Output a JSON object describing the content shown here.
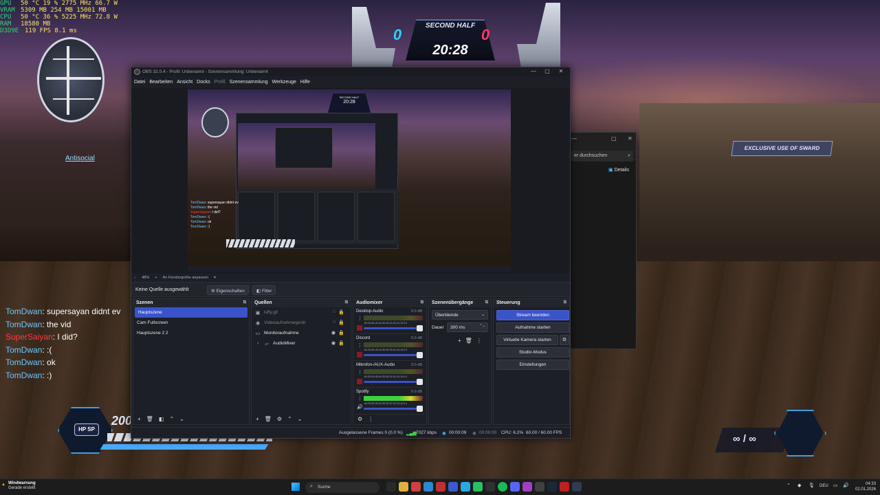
{
  "perf": {
    "rows": [
      {
        "k": "GPU",
        "v": "50 °C  19 %  2775 MHz  66.7 W"
      },
      {
        "k": "VRAM",
        "v": "5309 MB  254 MB  15001 MB"
      },
      {
        "k": "CPU",
        "v": "50 °C  36 %  5225 MHz  72.8 W"
      },
      {
        "k": "RAM",
        "v": "18580 MB"
      },
      {
        "k": "D3D9E",
        "v": "119 FPS  8.1 ms"
      }
    ]
  },
  "game": {
    "half_label": "SECOND HALF",
    "clock": "20:28",
    "score_left": "0",
    "score_right": "0",
    "player_tag": "Antisocial",
    "banner": "EXCLUSIVE USE OF SWARD",
    "hud_hp": "HP",
    "hud_sp": "SP",
    "hud_value": "200",
    "ammo": "∞ / ∞"
  },
  "chat": [
    {
      "name": "TomDwan",
      "msg": "supersayan didnt ev",
      "color": "#6cc6ff"
    },
    {
      "name": "TomDwan",
      "msg": "the vid",
      "color": "#6cc6ff"
    },
    {
      "name": "SuperSaiyan",
      "msg": "I did?",
      "color": "#ff3a44"
    },
    {
      "name": "TomDwan",
      "msg": ":(",
      "color": "#6cc6ff"
    },
    {
      "name": "TomDwan",
      "msg": "ok",
      "color": "#6cc6ff"
    },
    {
      "name": "TomDwan",
      "msg": ":)",
      "color": "#6cc6ff"
    }
  ],
  "explorer": {
    "search_placeholder": "er durchsuchen",
    "details_label": "Details"
  },
  "obs": {
    "title": "OBS 32.0.4 - Profil: Unbenannt - Szenensammlung: Unbenannt",
    "menu": [
      "Datei",
      "Bearbeiten",
      "Ansicht",
      "Docks",
      "Profil",
      "Szenensammlung",
      "Werkzeuge",
      "Hilfe"
    ],
    "zoom": {
      "minus": "−",
      "value": "48%",
      "plus": "+",
      "fit": "An Fenstergröße anpassen"
    },
    "no_source": "Keine Quelle ausgewählt",
    "properties_btn": "Eigenschaften",
    "filter_btn": "Filter",
    "scenes": {
      "title": "Szenen",
      "items": [
        "Hauptszene",
        "Cam Fullscreen",
        "Hauptszene 2 2"
      ]
    },
    "sources": {
      "title": "Quellen",
      "items": [
        {
          "label": "luffy.gif",
          "icon": "image-icon"
        },
        {
          "label": "Videoaufnahmegerät",
          "icon": "camera-icon"
        },
        {
          "label": "Monitoraufnahme",
          "icon": "monitor-icon"
        },
        {
          "label": "AudioMixer",
          "icon": "folder-icon"
        }
      ]
    },
    "mixer": {
      "title": "Audiomixer",
      "channels": [
        {
          "name": "Desktop-Audio",
          "db": "0.0 dB",
          "ticks": "-60-55-50-45-40-35-30-25-20-15-10-5 0"
        },
        {
          "name": "Discord",
          "db": "0.0 dB",
          "ticks": "-60-55-50-45-40-35-30-25-20-15-10-5 0"
        },
        {
          "name": "Mikrofon-/AUX-Audio",
          "db": "0.0 dB",
          "ticks": "-60-55-50-45-40-35-30-25-20-15-10-5 0"
        },
        {
          "name": "Spotify",
          "db": "0.0 dB",
          "ticks": "-60-55-50-45-40-35-30-25-20-15-10-5 0"
        }
      ]
    },
    "transitions": {
      "title": "Szenenübergänge",
      "selected": "Überblende",
      "duration_label": "Dauer",
      "duration": "300 ms"
    },
    "controls": {
      "title": "Steuerung",
      "stream": "Stream beenden",
      "record": "Aufnahme starten",
      "vcam": "Virtuelle Kamera starten",
      "studio": "Studio-Modus",
      "settings": "Einstellungen"
    },
    "status": {
      "dropped": "Ausgelassene Frames 0 (0.0 %)",
      "bitrate": "7027 kbps",
      "stream_time": "00:00:09",
      "rec_time": "00:00:00",
      "cpu": "CPU: 6.2%",
      "fps": "60.00 / 60.00 FPS"
    }
  },
  "taskbar": {
    "notif_title": "Windwarnung",
    "notif_sub": "Gerade erstellt",
    "search": "Suche",
    "lang": "DEU",
    "time": "04:33",
    "date": "02.01.2026"
  }
}
